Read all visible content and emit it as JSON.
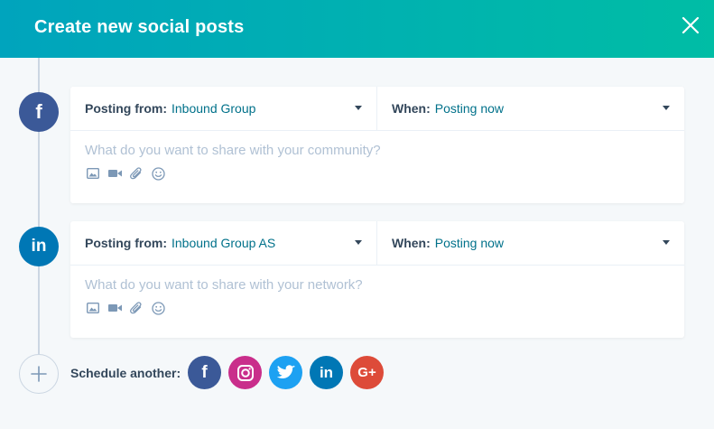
{
  "header": {
    "title": "Create new social posts",
    "close_icon": "close-icon"
  },
  "posts": [
    {
      "network": "facebook",
      "network_icon": "facebook-icon",
      "from_label": "Posting from:",
      "from_value": "Inbound Group",
      "when_label": "When:",
      "when_value": "Posting now",
      "placeholder": "What do you want to share with your community?",
      "tools": [
        "image-icon",
        "video-icon",
        "attachment-icon",
        "emoji-icon"
      ]
    },
    {
      "network": "linkedin",
      "network_icon": "linkedin-icon",
      "from_label": "Posting from:",
      "from_value": "Inbound Group AS",
      "when_label": "When:",
      "when_value": "Posting now",
      "placeholder": "What do you want to share with your network?",
      "tools": [
        "image-icon",
        "video-icon",
        "attachment-icon",
        "emoji-icon"
      ]
    }
  ],
  "schedule": {
    "label": "Schedule another:",
    "networks": [
      "facebook-icon",
      "instagram-icon",
      "twitter-icon",
      "linkedin-icon",
      "google-plus-icon"
    ]
  },
  "glyphs": {
    "facebook": "f",
    "linkedin": "in",
    "google_plus": "G+"
  },
  "colors": {
    "header_start": "#00a4bd",
    "header_end": "#00bda5",
    "facebook": "#3b5998",
    "linkedin": "#0077b5",
    "instagram": "#c92e8b",
    "twitter": "#1da1f2",
    "google_plus": "#dd4b39",
    "link_value": "#00718a"
  }
}
